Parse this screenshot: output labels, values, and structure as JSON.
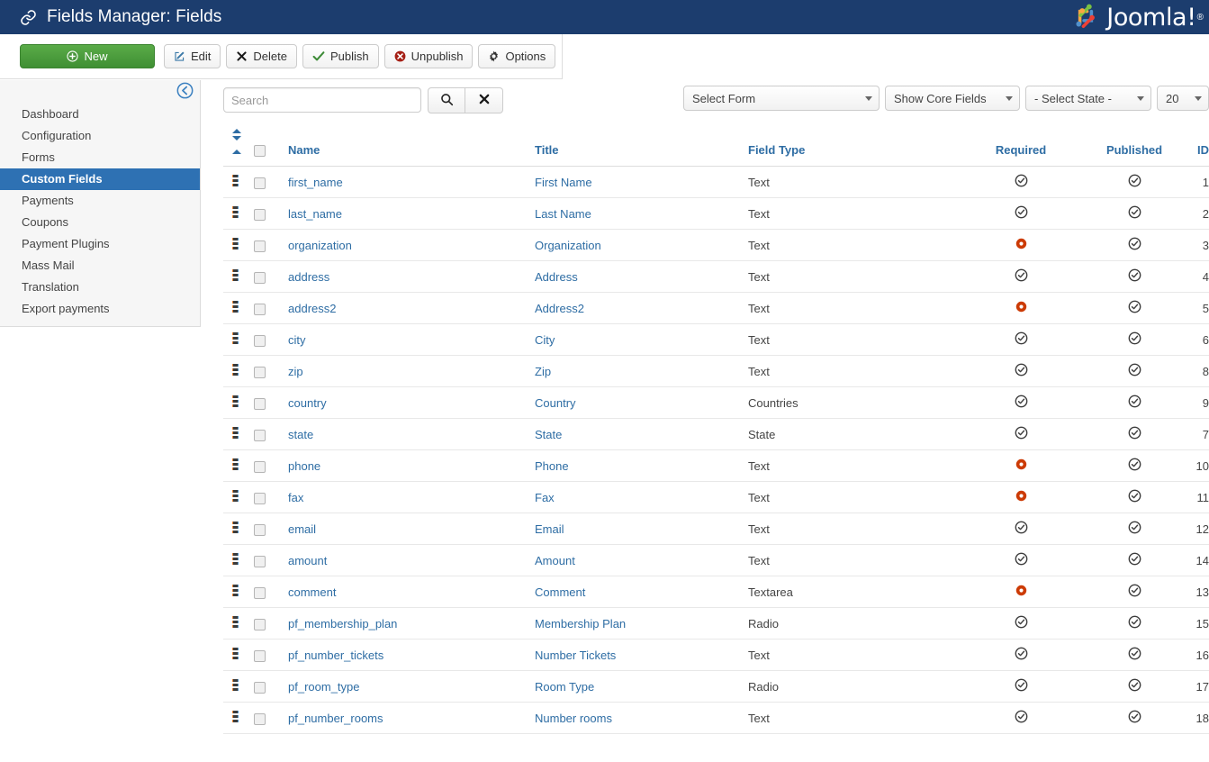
{
  "header": {
    "title": "Fields Manager: Fields",
    "icon": "link-icon",
    "brand": "Joomla!",
    "brand_mark": "®",
    "bar_color": "#1c3d6e"
  },
  "toolbar": {
    "buttons": [
      {
        "label": "New",
        "icon": "plus-circle-icon",
        "name": "new-button"
      },
      {
        "label": "Edit",
        "icon": "pencil-square-icon",
        "name": "edit-button"
      },
      {
        "label": "Delete",
        "icon": "x-mark-icon",
        "name": "delete-button"
      },
      {
        "label": "Publish",
        "icon": "check-icon",
        "name": "publish-button"
      },
      {
        "label": "Unpublish",
        "icon": "x-circle-icon",
        "name": "unpublish-button"
      },
      {
        "label": "Options",
        "icon": "gear-icon",
        "name": "options-button"
      }
    ],
    "new_color": "#3f8f33"
  },
  "sidebar": {
    "collapse_icon": "arrow-left-circle-icon",
    "items": [
      {
        "label": "Dashboard",
        "active": false
      },
      {
        "label": "Configuration",
        "active": false
      },
      {
        "label": "Forms",
        "active": false
      },
      {
        "label": "Custom Fields",
        "active": true
      },
      {
        "label": "Payments",
        "active": false
      },
      {
        "label": "Coupons",
        "active": false
      },
      {
        "label": "Payment Plugins",
        "active": false
      },
      {
        "label": "Mass Mail",
        "active": false
      },
      {
        "label": "Translation",
        "active": false
      },
      {
        "label": "Export payments",
        "active": false
      }
    ],
    "active_color": "#2e71b3"
  },
  "filters": {
    "search": {
      "value": "",
      "placeholder": "Search"
    },
    "search_button_icon": "search-icon",
    "clear_button_icon": "clear-x-icon",
    "select_form": "Select Form",
    "select_core": "Show Core Fields",
    "select_state": "- Select State -",
    "select_limit": "20"
  },
  "table": {
    "columns": [
      "Name",
      "Title",
      "Field Type",
      "Required",
      "Published",
      "ID"
    ],
    "header_color": "#2e6da4",
    "required_true_color": "#cc3b06",
    "rows": [
      {
        "name": "first_name",
        "title": "First Name",
        "type": "Text",
        "required": false,
        "published": true,
        "id": "1"
      },
      {
        "name": "last_name",
        "title": "Last Name",
        "type": "Text",
        "required": false,
        "published": true,
        "id": "2"
      },
      {
        "name": "organization",
        "title": "Organization",
        "type": "Text",
        "required": true,
        "published": true,
        "id": "3"
      },
      {
        "name": "address",
        "title": "Address",
        "type": "Text",
        "required": false,
        "published": true,
        "id": "4"
      },
      {
        "name": "address2",
        "title": "Address2",
        "type": "Text",
        "required": true,
        "published": true,
        "id": "5"
      },
      {
        "name": "city",
        "title": "City",
        "type": "Text",
        "required": false,
        "published": true,
        "id": "6"
      },
      {
        "name": "zip",
        "title": "Zip",
        "type": "Text",
        "required": false,
        "published": true,
        "id": "8"
      },
      {
        "name": "country",
        "title": "Country",
        "type": "Countries",
        "required": false,
        "published": true,
        "id": "9"
      },
      {
        "name": "state",
        "title": "State",
        "type": "State",
        "required": false,
        "published": true,
        "id": "7"
      },
      {
        "name": "phone",
        "title": "Phone",
        "type": "Text",
        "required": true,
        "published": true,
        "id": "10"
      },
      {
        "name": "fax",
        "title": "Fax",
        "type": "Text",
        "required": true,
        "published": true,
        "id": "11"
      },
      {
        "name": "email",
        "title": "Email",
        "type": "Text",
        "required": false,
        "published": true,
        "id": "12"
      },
      {
        "name": "amount",
        "title": "Amount",
        "type": "Text",
        "required": false,
        "published": true,
        "id": "14"
      },
      {
        "name": "comment",
        "title": "Comment",
        "type": "Textarea",
        "required": true,
        "published": true,
        "id": "13"
      },
      {
        "name": "pf_membership_plan",
        "title": "Membership Plan",
        "type": "Radio",
        "required": false,
        "published": true,
        "id": "15"
      },
      {
        "name": "pf_number_tickets",
        "title": "Number Tickets",
        "type": "Text",
        "required": false,
        "published": true,
        "id": "16"
      },
      {
        "name": "pf_room_type",
        "title": "Room Type",
        "type": "Radio",
        "required": false,
        "published": true,
        "id": "17"
      },
      {
        "name": "pf_number_rooms",
        "title": "Number rooms",
        "type": "Text",
        "required": false,
        "published": true,
        "id": "18"
      }
    ]
  }
}
